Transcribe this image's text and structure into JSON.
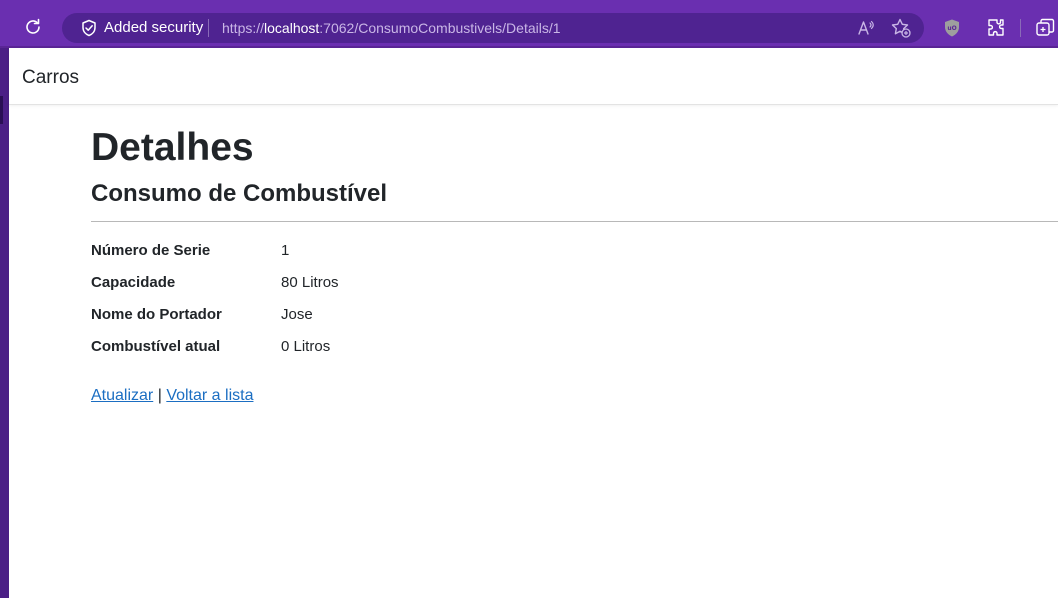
{
  "browser": {
    "security_label": "Added security",
    "url_scheme": "https://",
    "url_host": "localhost",
    "url_rest": ":7062/ConsumoCombustivels/Details/1",
    "icons": [
      "refresh-icon",
      "shield-icon",
      "read-aloud-icon",
      "favorites-icon",
      "ublock-icon",
      "extensions-icon",
      "collections-icon"
    ]
  },
  "navbar": {
    "brand": "Carros"
  },
  "page": {
    "title": "Detalhes",
    "subtitle": "Consumo de Combustível"
  },
  "details": [
    {
      "term": "Número de Serie",
      "value": "1"
    },
    {
      "term": "Capacidade",
      "value": "80 Litros"
    },
    {
      "term": "Nome do Portador",
      "value": "Jose"
    },
    {
      "term": "Combustível atual",
      "value": "0 Litros"
    }
  ],
  "actions": {
    "edit_label": "Atualizar",
    "separator": "|",
    "back_label": "Voltar a lista"
  },
  "colors": {
    "browser_bar": "#6a2fb0",
    "address_pill": "#4f2391",
    "link": "#1b6ec2",
    "text": "#212529"
  }
}
